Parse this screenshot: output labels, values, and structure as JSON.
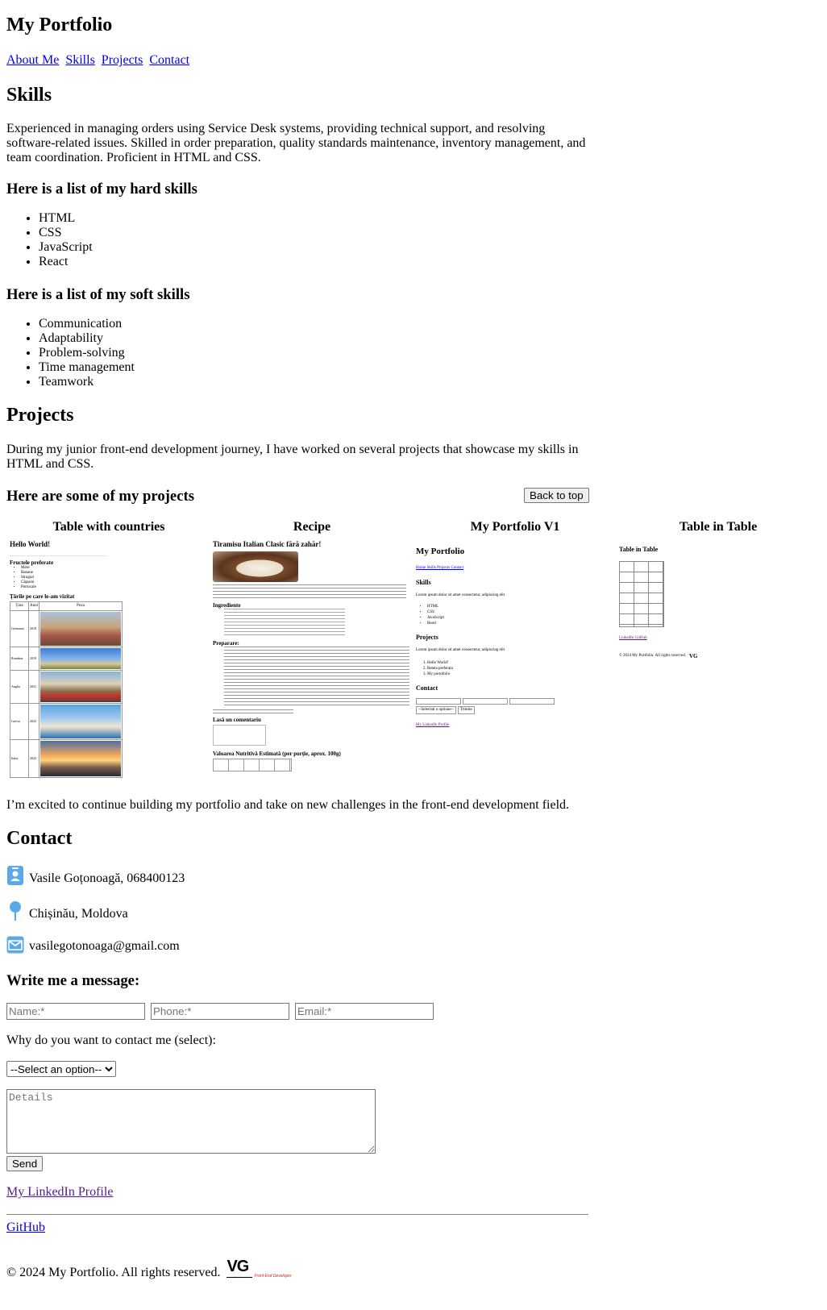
{
  "header": {
    "title": "My Portfolio"
  },
  "nav": {
    "items": [
      "About Me",
      "Skills",
      "Projects",
      "Contact"
    ]
  },
  "skills": {
    "heading": "Skills",
    "intro": "Experienced in managing orders using Service Desk systems, providing technical support, and resolving software-related issues. Skilled in order preparation, quality standards maintenance, inventory management, and team coordination. Proficient in HTML and CSS.",
    "hard_heading": "Here is a list of my hard skills",
    "hard": [
      "HTML",
      "CSS",
      "JavaScript",
      "React"
    ],
    "soft_heading": "Here is a list of my soft skills",
    "soft": [
      "Communication",
      "Adaptability",
      "Problem-solving",
      "Time management",
      "Teamwork"
    ]
  },
  "projects": {
    "heading": "Projects",
    "intro": "During my junior front-end development journey, I have worked on several projects that showcase my skills in HTML and CSS.",
    "list_heading": "Here are some of my projects",
    "back_to_top": "Back to top",
    "items": [
      {
        "title": "Table with countries"
      },
      {
        "title": "Recipe"
      },
      {
        "title": "My Portfolio V1"
      },
      {
        "title": "Table in Table"
      }
    ],
    "outro": "I’m excited to continue building my portfolio and take on new challenges in the front-end development field."
  },
  "thumbs": {
    "countries": {
      "title": "Hello World!",
      "subtitle": "Fructele preferate",
      "fruits": [
        "Mere",
        "Banane",
        "Struguri",
        "Căpșuni",
        "Portocale"
      ],
      "table_title": "Țările pe care le-am vizitat",
      "cols": [
        "Țara",
        "Anul",
        "Poza"
      ],
      "rows": [
        {
          "country": "Germania",
          "year": "2018"
        },
        {
          "country": "România",
          "year": "2019"
        },
        {
          "country": "Anglia",
          "year": "2021"
        },
        {
          "country": "Grecia",
          "year": "2023"
        },
        {
          "country": "Italia",
          "year": "2022"
        }
      ]
    },
    "recipe": {
      "title": "Tiramisu Italian Clasic fără zahăr!",
      "ingredients_heading": "Ingrediente",
      "preparation_heading": "Preparare:",
      "comment_heading": "Lasă un comentariu",
      "nutrition_heading": "Valoarea Nutritivă Estimată (per porție, aprox. 100g)"
    },
    "portfolio_v1": {
      "title": "My Portfolio",
      "nav": "Home Skills Projects Contact",
      "skills": "Skills",
      "lorem": "Lorem ipsum dolor sit amet consectetur, adipiscing elit",
      "list": [
        "HTML",
        "CSS",
        "JavaScript",
        "React"
      ],
      "projects": "Projects",
      "projects_list": [
        "Hello World!",
        "Reteta preferata",
        "My portofolio"
      ],
      "contact": "Contact",
      "select": "--Selectati o optiune--",
      "trimite": "Trimite",
      "linkedin": "My LinkedIn Profile"
    },
    "table_in_table": {
      "title": "Table in Table",
      "links": "LinkedIn GitHub",
      "footer": "© 2024 My Portfolio. All rights reserved."
    }
  },
  "contact": {
    "heading": "Contact",
    "person": "Vasile Goțonoagă, 068400123",
    "location": "Chișinău, Moldova",
    "email": "vasilegotonoaga@gmail.com",
    "message_heading": "Write me a message:",
    "name_placeholder": "Name:*",
    "phone_placeholder": "Phone:*",
    "email_placeholder": "Email:*",
    "reason_label": "Why do you want to contact me (select):",
    "select_option": "--Select an option--",
    "details_placeholder": "Details",
    "send": "Send",
    "linkedin": "My LinkedIn Profile",
    "github": "GitHub"
  },
  "footer": {
    "copyright": "© 2024 My Portfolio. All rights reserved.",
    "logo_text": "VG",
    "logo_sub": "Front End Developer"
  },
  "colors": {
    "link": "#0000ee",
    "visited": "#551a8b",
    "icon": "#5aa9e6",
    "logo_red": "#d42020"
  }
}
